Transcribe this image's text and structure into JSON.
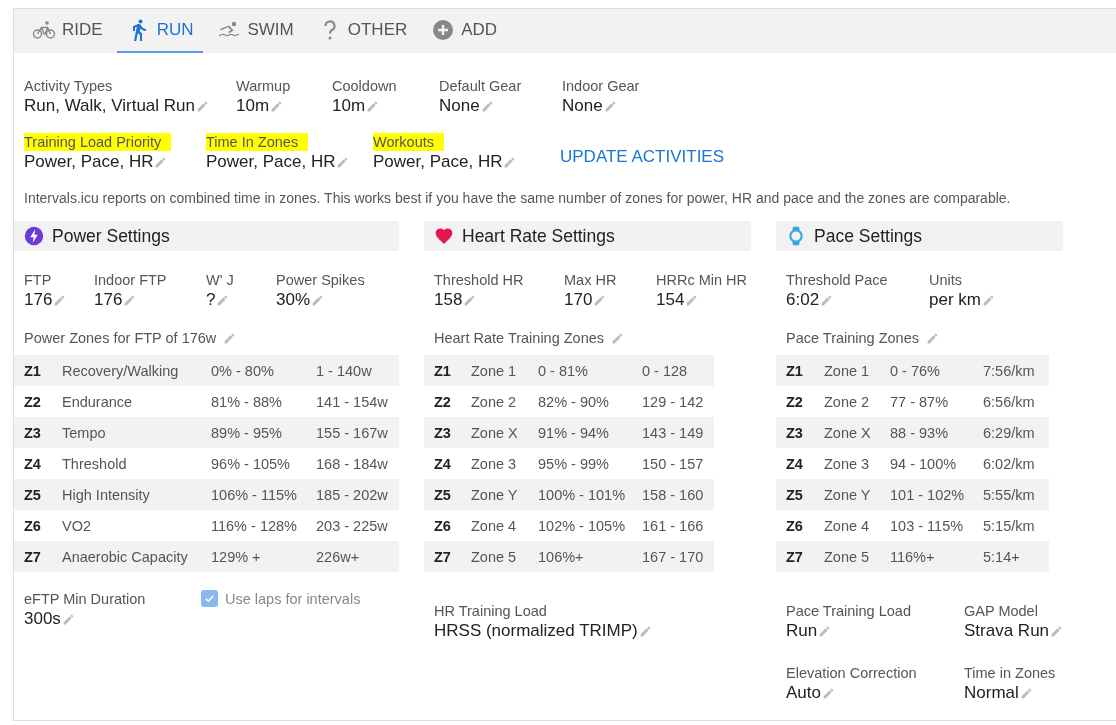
{
  "tabs": [
    {
      "label": "RIDE",
      "kind": "ride",
      "selected": false
    },
    {
      "label": "RUN",
      "kind": "run",
      "selected": true
    },
    {
      "label": "SWIM",
      "kind": "swim",
      "selected": false
    },
    {
      "label": "OTHER",
      "kind": "other",
      "selected": false
    },
    {
      "label": "ADD",
      "kind": "add",
      "selected": false
    }
  ],
  "general": {
    "rows": [
      [
        {
          "label": "Activity Types",
          "value": "Run, Walk, Virtual Run",
          "highlighted": false
        },
        {
          "label": "Warmup",
          "value": "10m",
          "highlighted": false
        },
        {
          "label": "Cooldown",
          "value": "10m",
          "highlighted": false
        },
        {
          "label": "Default Gear",
          "value": "None",
          "highlighted": false
        },
        {
          "label": "Indoor Gear",
          "value": "None",
          "highlighted": false
        }
      ],
      [
        {
          "label": "Training Load Priority",
          "value": "Power, Pace, HR",
          "highlighted": true
        },
        {
          "label": "Time In Zones",
          "value": "Power, Pace, HR",
          "highlighted": true
        },
        {
          "label": "Workouts",
          "value": "Power, Pace, HR",
          "highlighted": true
        }
      ]
    ],
    "update_button": "UPDATE ACTIVITIES",
    "note": "Intervals.icu reports on combined time in zones. This works best if you have the same number of zones for power, HR and pace and the zones are comparable."
  },
  "sections": [
    {
      "kind": "power",
      "title": "Power Settings",
      "fields": [
        {
          "label": "FTP",
          "value": "176"
        },
        {
          "label": "Indoor FTP",
          "value": "176"
        },
        {
          "label": "W' J",
          "value": "?"
        },
        {
          "label": "Power Spikes",
          "value": "30%"
        }
      ],
      "zones_title": "Power Zones for FTP of 176w",
      "zones": [
        {
          "zone": "Z1",
          "name": "Recovery/Walking",
          "percent": "0% - 80%",
          "range": "1 - 140w"
        },
        {
          "zone": "Z2",
          "name": "Endurance",
          "percent": "81% - 88%",
          "range": "141 - 154w"
        },
        {
          "zone": "Z3",
          "name": "Tempo",
          "percent": "89% - 95%",
          "range": "155 - 167w"
        },
        {
          "zone": "Z4",
          "name": "Threshold",
          "percent": "96% - 105%",
          "range": "168 - 184w"
        },
        {
          "zone": "Z5",
          "name": "High Intensity",
          "percent": "106% - 115%",
          "range": "185 - 202w"
        },
        {
          "zone": "Z6",
          "name": "VO2",
          "percent": "116% - 128%",
          "range": "203 - 225w"
        },
        {
          "zone": "Z7",
          "name": "Anaerobic Capacity",
          "percent": "129% +",
          "range": "226w+"
        }
      ],
      "footer_fields": [
        {
          "label": "eFTP Min Duration",
          "value": "300s"
        }
      ],
      "checkbox": {
        "label": "Use laps for intervals",
        "checked": true
      }
    },
    {
      "kind": "hr",
      "title": "Heart Rate Settings",
      "fields": [
        {
          "label": "Threshold HR",
          "value": "158"
        },
        {
          "label": "Max HR",
          "value": "170"
        },
        {
          "label": "HRRc Min HR",
          "value": "154"
        }
      ],
      "zones_title": "Heart Rate Training Zones",
      "zones": [
        {
          "zone": "Z1",
          "name": "Zone 1",
          "percent": "0 - 81%",
          "range": "0 - 128"
        },
        {
          "zone": "Z2",
          "name": "Zone 2",
          "percent": "82% - 90%",
          "range": "129 - 142"
        },
        {
          "zone": "Z3",
          "name": "Zone X",
          "percent": "91% - 94%",
          "range": "143 - 149"
        },
        {
          "zone": "Z4",
          "name": "Zone 3",
          "percent": "95% - 99%",
          "range": "150 - 157"
        },
        {
          "zone": "Z5",
          "name": "Zone Y",
          "percent": "100% - 101%",
          "range": "158 - 160"
        },
        {
          "zone": "Z6",
          "name": "Zone 4",
          "percent": "102% - 105%",
          "range": "161 - 166"
        },
        {
          "zone": "Z7",
          "name": "Zone 5",
          "percent": "106%+",
          "range": "167 - 170"
        }
      ],
      "footer_fields": [
        {
          "label": "HR Training Load",
          "value": "HRSS (normalized TRIMP)"
        }
      ]
    },
    {
      "kind": "pace",
      "title": "Pace Settings",
      "fields": [
        {
          "label": "Threshold Pace",
          "value": "6:02"
        },
        {
          "label": "Units",
          "value": "per km"
        }
      ],
      "zones_title": "Pace Training Zones",
      "zones": [
        {
          "zone": "Z1",
          "name": "Zone 1",
          "percent": "0 - 76%",
          "range": "7:56/km"
        },
        {
          "zone": "Z2",
          "name": "Zone 2",
          "percent": "77 - 87%",
          "range": "6:56/km"
        },
        {
          "zone": "Z3",
          "name": "Zone X",
          "percent": "88 - 93%",
          "range": "6:29/km"
        },
        {
          "zone": "Z4",
          "name": "Zone 3",
          "percent": "94 - 100%",
          "range": "6:02/km"
        },
        {
          "zone": "Z5",
          "name": "Zone Y",
          "percent": "101 - 102%",
          "range": "5:55/km"
        },
        {
          "zone": "Z6",
          "name": "Zone 4",
          "percent": "103 - 115%",
          "range": "5:15/km"
        },
        {
          "zone": "Z7",
          "name": "Zone 5",
          "percent": "116%+",
          "range": "5:14+"
        }
      ],
      "footer_fields": [
        {
          "label": "Pace Training Load",
          "value": "Run"
        },
        {
          "label": "GAP Model",
          "value": "Strava Run"
        },
        {
          "label": "Elevation Correction",
          "value": "Auto"
        },
        {
          "label": "Time in Zones",
          "value": "Normal"
        }
      ]
    }
  ]
}
